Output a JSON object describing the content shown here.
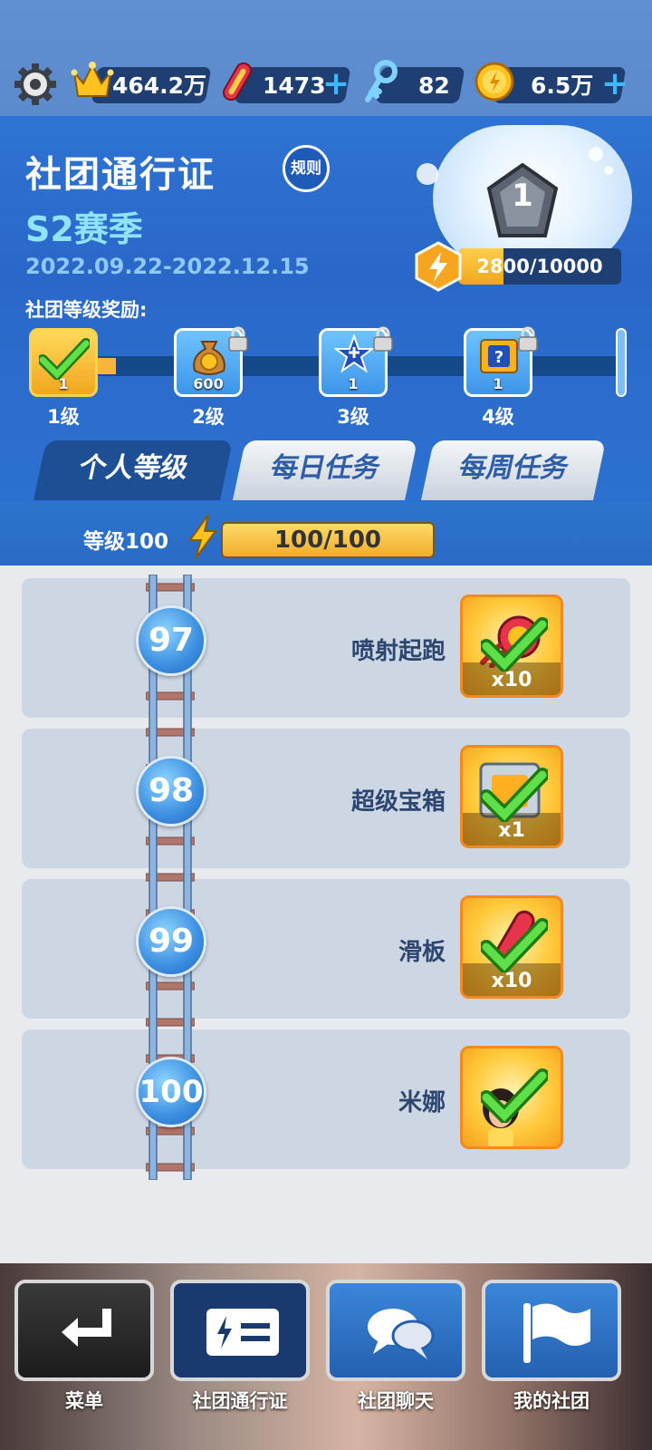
{
  "resources": {
    "crowns": "464.2万",
    "hoverboards": "1473",
    "keys": "82",
    "coins": "6.5万"
  },
  "header": {
    "title": "社团通行证",
    "rules_label": "规则",
    "season": "S2赛季",
    "dates": "2022.09.22-2022.12.15",
    "badge_level": "1",
    "xp_text": "2800/10000",
    "xp_progress": 0.28,
    "reward_label": "社团等级奖励:"
  },
  "rewards": [
    {
      "level": "1级",
      "count": "1",
      "locked": false
    },
    {
      "level": "2级",
      "count": "600",
      "locked": true
    },
    {
      "level": "3级",
      "count": "1",
      "locked": true
    },
    {
      "level": "4级",
      "count": "1",
      "locked": true
    }
  ],
  "tabs": [
    {
      "label": "个人等级",
      "active": true
    },
    {
      "label": "每日任务",
      "active": false
    },
    {
      "label": "每周任务",
      "active": false
    }
  ],
  "level_bar": {
    "label": "等级100",
    "text": "100/100",
    "progress": 1.0
  },
  "levels": [
    {
      "num": "97",
      "name": "喷射起跑",
      "count": "x10"
    },
    {
      "num": "98",
      "name": "超级宝箱",
      "count": "x1"
    },
    {
      "num": "99",
      "name": "滑板",
      "count": "x10"
    },
    {
      "num": "100",
      "name": "米娜",
      "count": ""
    }
  ],
  "nav": [
    {
      "label": "菜单"
    },
    {
      "label": "社团通行证"
    },
    {
      "label": "社团聊天"
    },
    {
      "label": "我的社团"
    }
  ],
  "colors": {
    "accent_blue": "#2c71d0",
    "gold": "#f0a61e",
    "check_green": "#3cc21e"
  }
}
